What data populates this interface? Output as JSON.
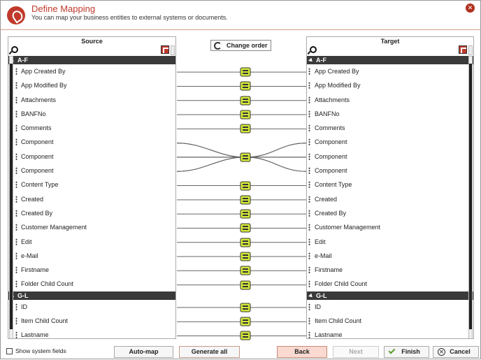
{
  "header": {
    "title": "Define Mapping",
    "subtitle": "You can map your business entities to external systems or documents."
  },
  "source": {
    "title": "Source",
    "groups": [
      {
        "label": "A-F",
        "items": [
          "App Created By",
          "App Modified By",
          "Attachments",
          "BANFNo",
          "Comments",
          "Component",
          "Component",
          "Component",
          "Content Type",
          "Created",
          "Created By",
          "Customer Management",
          "Edit",
          "e-Mail",
          "Firstname",
          "Folder Child Count"
        ]
      },
      {
        "label": "G-L",
        "items": [
          "ID",
          "Item Child Count",
          "Lastname"
        ]
      }
    ]
  },
  "target": {
    "title": "Target",
    "groups": [
      {
        "label": "A-F",
        "items": [
          "App Created By",
          "App Modified By",
          "Attachments",
          "BANFNo",
          "Comments",
          "Component",
          "Component",
          "Component",
          "Content Type",
          "Created",
          "Created By",
          "Customer Management",
          "Edit",
          "e-Mail",
          "Firstname",
          "Folder Child Count"
        ]
      },
      {
        "label": "G-L",
        "items": [
          "ID",
          "Item Child Count",
          "Lastname"
        ]
      }
    ]
  },
  "toolbar": {
    "change_order_label": "Change order"
  },
  "footer": {
    "show_system_fields_label": "Show system fields",
    "auto_map_label": "Auto-map",
    "generate_all_label": "Generate all",
    "back_label": "Back",
    "next_label": "Next",
    "finish_label": "Finish",
    "cancel_label": "Cancel"
  },
  "colors": {
    "accent": "#c0392b",
    "link_node": "#d4e83a",
    "group_header": "#3a3a3a"
  }
}
